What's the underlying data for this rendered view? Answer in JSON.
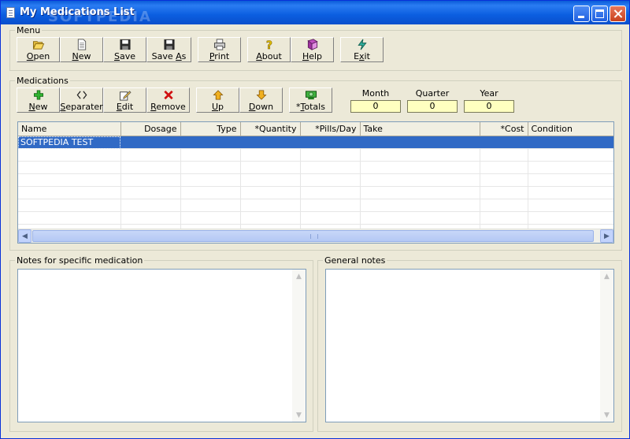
{
  "window": {
    "title": "My Medications List",
    "watermark": "SOFTPEDIA"
  },
  "menu_group": {
    "legend": "Menu",
    "buttons": [
      {
        "key": "O",
        "rest": "pen",
        "icon": "folder-open-icon"
      },
      {
        "key": "N",
        "rest": "ew",
        "icon": "new-document-icon"
      },
      {
        "key": "S",
        "rest": "ave",
        "icon": "floppy-disk-icon"
      },
      {
        "pre": "Save ",
        "key": "A",
        "rest": "s",
        "icon": "floppy-disk-icon"
      },
      {
        "key": "P",
        "rest": "rint",
        "icon": "printer-icon"
      },
      {
        "key": "A",
        "rest": "bout",
        "icon": "question-mark-icon"
      },
      {
        "key": "H",
        "rest": "elp",
        "icon": "help-book-icon"
      },
      {
        "pre": "E",
        "key": "x",
        "rest": "it",
        "icon": "exit-icon"
      }
    ]
  },
  "medications_group": {
    "legend": "Medications",
    "buttons": [
      {
        "key": "N",
        "rest": "ew",
        "icon": "plus-icon"
      },
      {
        "key": "S",
        "rest": "eparater",
        "icon": "separator-icon"
      },
      {
        "key": "E",
        "rest": "dit",
        "icon": "edit-icon"
      },
      {
        "key": "R",
        "rest": "emove",
        "icon": "remove-x-icon"
      },
      {
        "key": "U",
        "rest": "p",
        "icon": "arrow-up-icon"
      },
      {
        "key": "D",
        "rest": "own",
        "icon": "arrow-down-icon"
      },
      {
        "pre": "*",
        "key": "T",
        "rest": "otals",
        "icon": "money-icon"
      }
    ],
    "totals": [
      {
        "label": "Month",
        "value": "0"
      },
      {
        "label": "Quarter",
        "value": "0"
      },
      {
        "label": "Year",
        "value": "0"
      }
    ]
  },
  "table": {
    "columns": [
      "Name",
      "Dosage",
      "Type",
      "*Quantity",
      "*Pills/Day",
      "Take",
      "*Cost",
      "Condition"
    ],
    "rows": [
      [
        "SOFTPEDIA TEST",
        "",
        "",
        "",
        "",
        "",
        "",
        ""
      ]
    ]
  },
  "notes": {
    "specific_legend": "Notes for specific medication",
    "general_legend": "General notes",
    "specific_text": "",
    "general_text": ""
  },
  "colors": {
    "titlebar": "#0a5bd8",
    "selection": "#316ac5",
    "totals_bg": "#ffffc0",
    "window_bg": "#ece9d8"
  }
}
